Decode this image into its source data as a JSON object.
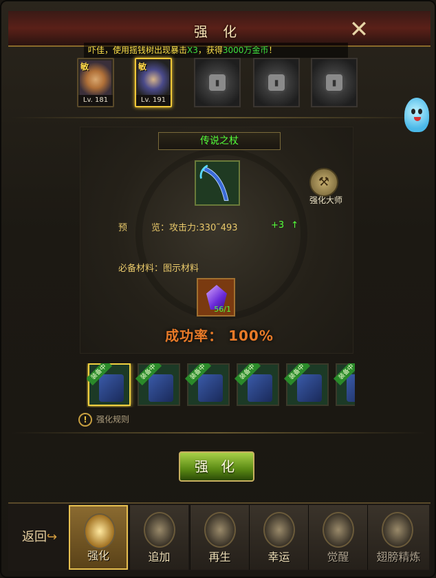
{
  "header": {
    "title": "强 化"
  },
  "marquee": {
    "pre": "吓佳，使用摇钱树出现暴击",
    "mult": "X3",
    "mid": "，获得",
    "amount": "3000万金币",
    "post": "！"
  },
  "heroes": [
    {
      "tag": "敏",
      "level": "Lv. 181",
      "selected": false
    },
    {
      "tag": "敏",
      "level": "Lv. 191",
      "selected": true
    }
  ],
  "item": {
    "name": "传说之杖"
  },
  "master": {
    "label": "强化大师"
  },
  "preview": {
    "label_a": "预",
    "label_b": "览：",
    "stat_label": "攻击力:",
    "stat_value": "330˜493",
    "bonus": "+3",
    "bonus_icon": "up-arrow-icon"
  },
  "materials": {
    "label": "必备材料：图示材料",
    "count": "56/1"
  },
  "success": {
    "text": "成功率： 100%"
  },
  "equips": [
    {
      "badge": "装备中",
      "selected": true
    },
    {
      "badge": "装备中",
      "selected": false
    },
    {
      "badge": "装备中",
      "selected": false
    },
    {
      "badge": "装备中",
      "selected": false
    },
    {
      "badge": "装备中",
      "selected": false
    },
    {
      "badge": "装备中",
      "selected": false
    }
  ],
  "rules": {
    "label": "强化规则"
  },
  "actions": {
    "strengthen_button": "强 化",
    "back": "返回"
  },
  "tabs": [
    {
      "label": "强化",
      "active": true
    },
    {
      "label": "追加",
      "active": false
    },
    {
      "label": "再生",
      "active": false
    },
    {
      "label": "幸运",
      "active": false
    },
    {
      "label": "觉醒",
      "active": false
    },
    {
      "label": "翅膀精炼",
      "active": false
    }
  ],
  "colors": {
    "accent_green": "#53ff3a",
    "gold": "#e8c86a",
    "orange": "#e87a28"
  }
}
